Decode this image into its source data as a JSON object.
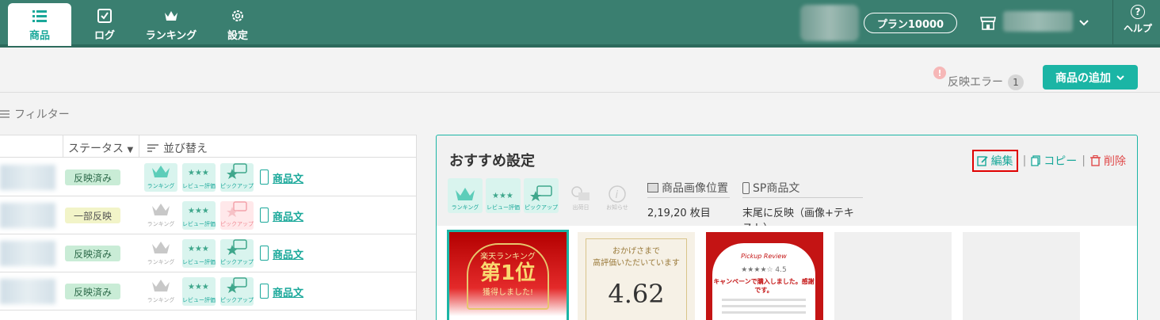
{
  "nav": {
    "tabs": [
      {
        "label": "商品",
        "icon": "list-icon",
        "active": true
      },
      {
        "label": "ログ",
        "icon": "checkbox-icon",
        "active": false
      },
      {
        "label": "ランキング",
        "icon": "crown-icon",
        "active": false
      },
      {
        "label": "設定",
        "icon": "gear-icon",
        "active": false
      }
    ],
    "plan_label": "プラン10000",
    "help_label": "ヘルプ",
    "help_icon": "?"
  },
  "toolbar": {
    "error_icon": "!",
    "error_label": "反映エラー",
    "error_count": "1",
    "add_button_label": "商品の追加",
    "filter_label": "フィルター"
  },
  "table": {
    "status_header": "ステータス",
    "sort_label": "並び替え",
    "badge_labels": {
      "ranking": "ランキング",
      "review": "レビュー評価",
      "pickup": "ピックアップ"
    },
    "doc_link_label": "商品文",
    "rows": [
      {
        "status": "反映済み",
        "status_type": "done",
        "ranking": "on",
        "review": "on",
        "pickup": "on"
      },
      {
        "status": "一部反映",
        "status_type": "partial",
        "ranking": "off",
        "review": "on",
        "pickup": "warn"
      },
      {
        "status": "反映済み",
        "status_type": "done",
        "ranking": "off",
        "review": "on",
        "pickup": "on"
      },
      {
        "status": "反映済み",
        "status_type": "done",
        "ranking": "off",
        "review": "on",
        "pickup": "on"
      }
    ]
  },
  "panel": {
    "title": "おすすめ設定",
    "edit_label": "編集",
    "copy_label": "コピー",
    "delete_label": "削除",
    "badges": {
      "ranking": "ランキング",
      "review": "レビュー評価",
      "pickup": "ピックアップ",
      "release": "出荷日",
      "notice": "お知らせ"
    },
    "image_position_label": "商品画像位置",
    "image_position_value": "2,19,20 枚目",
    "sp_text_label": "SP商品文",
    "sp_text_value": "末尾に反映（画像+テキスト）",
    "thumbnails": {
      "t1_top": "楽天ランキング",
      "t1_big": "第1位",
      "t1_sub": "獲得しました!",
      "t2_top": "おかげさまで",
      "t2_sub": "高評価いただいています",
      "t2_score": "4.62",
      "t3_top": "Pickup Review",
      "t3_rating": "★★★★☆ 4.5",
      "t3_text": "キャンペーンで購入しました。感謝です。"
    }
  },
  "colors": {
    "brand": "#3a7f70",
    "accent": "#1bb5a5",
    "danger": "#e04a4a",
    "highlight": "#e00000"
  }
}
